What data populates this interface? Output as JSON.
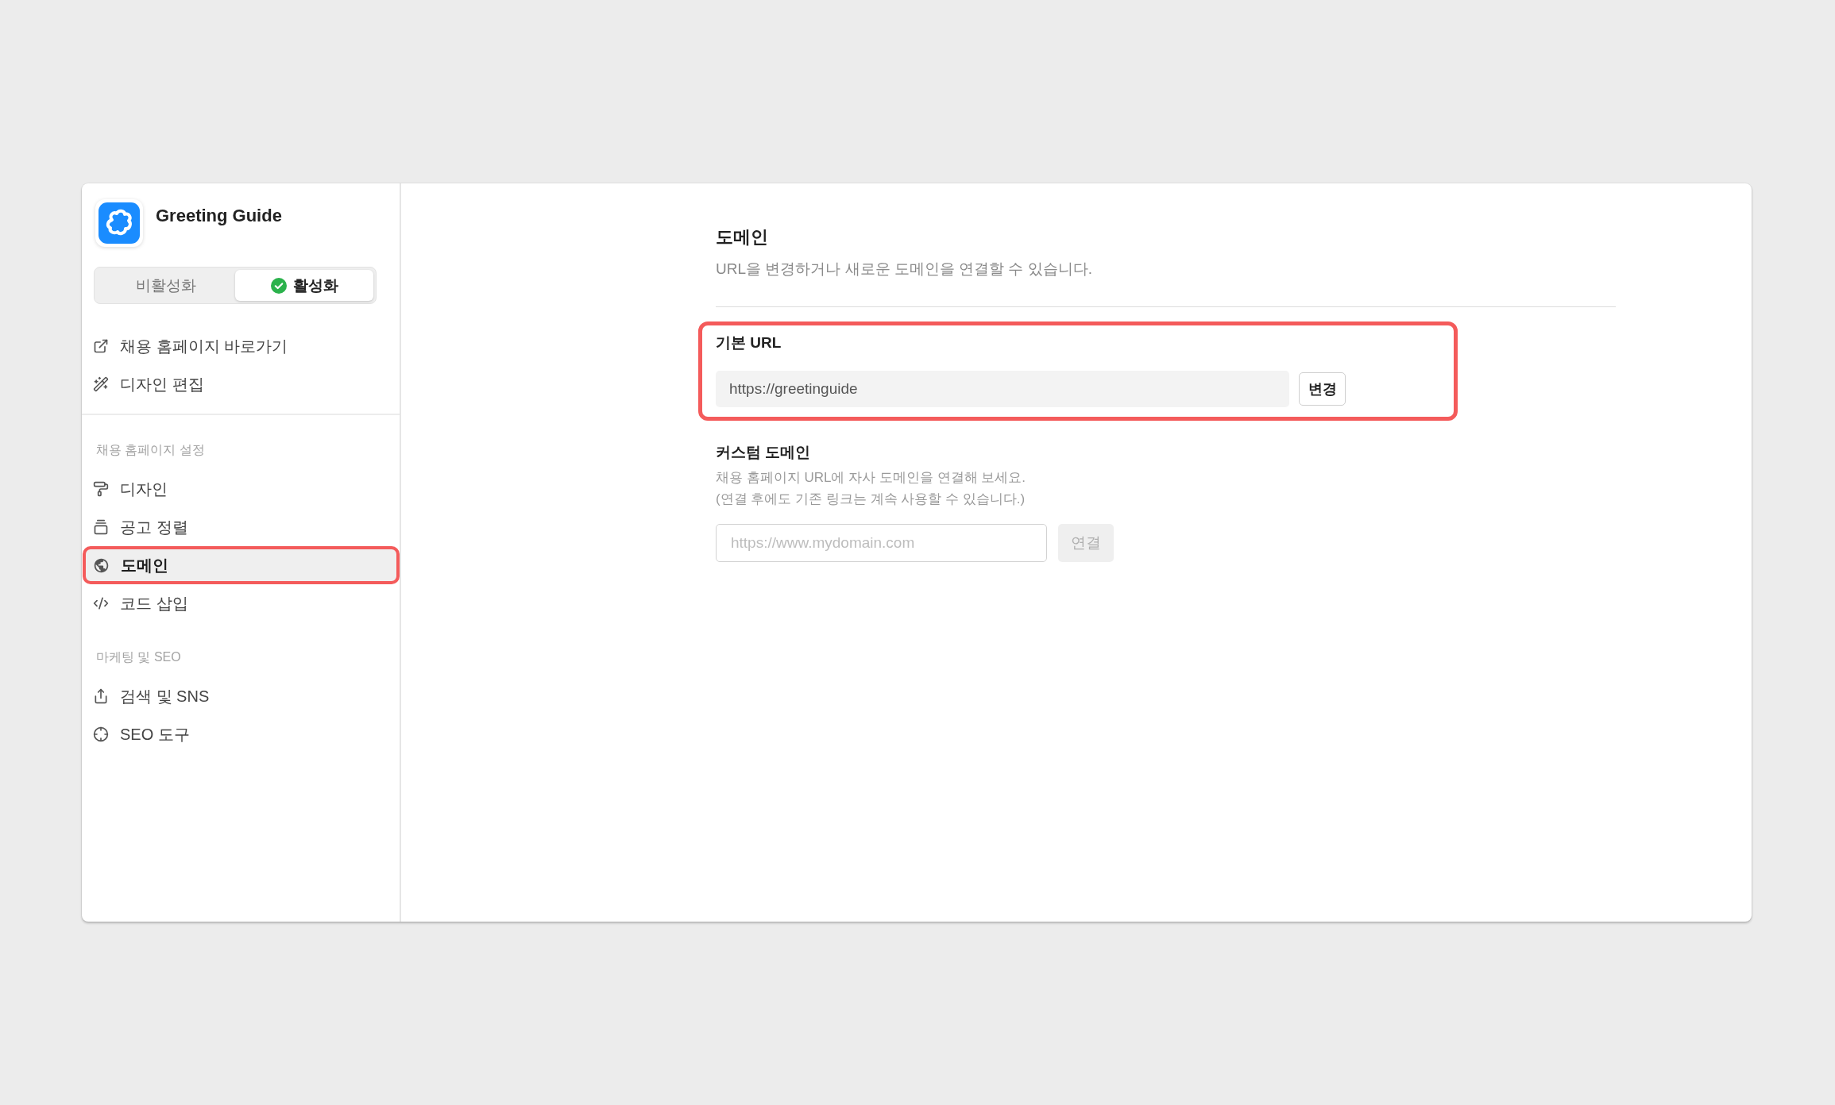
{
  "app": {
    "name": "Greeting Guide"
  },
  "status_toggle": [
    {
      "label": "비활성화",
      "selected": false
    },
    {
      "label": "활성화",
      "selected": true
    }
  ],
  "quick_links": [
    {
      "label": "채용 홈페이지 바로가기",
      "kind": "external"
    },
    {
      "label": "디자인 편집",
      "kind": "wand"
    }
  ],
  "sidebar": {
    "sections": [
      {
        "title": "채용 홈페이지 설정",
        "items": [
          {
            "label": "디자인",
            "kind": "roller",
            "selected": false,
            "highlighted": false
          },
          {
            "label": "공고 정렬",
            "kind": "stack",
            "selected": false,
            "highlighted": false
          },
          {
            "label": "도메인",
            "kind": "globe",
            "selected": true,
            "highlighted": true
          },
          {
            "label": "코드 삽입",
            "kind": "code",
            "selected": false,
            "highlighted": false
          }
        ]
      },
      {
        "title": "마케팅 및 SEO",
        "items": [
          {
            "label": "검색 및 SNS",
            "kind": "share",
            "selected": false,
            "highlighted": false
          },
          {
            "label": "SEO 도구",
            "kind": "crosshair",
            "selected": false,
            "highlighted": false
          }
        ]
      }
    ]
  },
  "page": {
    "title": "도메인",
    "subtitle": "URL을 변경하거나 새로운 도메인을 연결할 수 있습니다."
  },
  "basic_url": {
    "label": "기본 URL",
    "value": "https://greetinguide",
    "button": {
      "label": "변경"
    },
    "highlighted": true
  },
  "custom_domain": {
    "label": "커스텀 도메인",
    "description": [
      "채용 홈페이지 URL에 자사 도메인을 연결해 보세요.",
      "(연결 후에도 기존 링크는 계속 사용할 수 있습니다.)"
    ],
    "placeholder": "https://www.mydomain.com",
    "button": {
      "label": "연결",
      "disabled": true
    }
  }
}
